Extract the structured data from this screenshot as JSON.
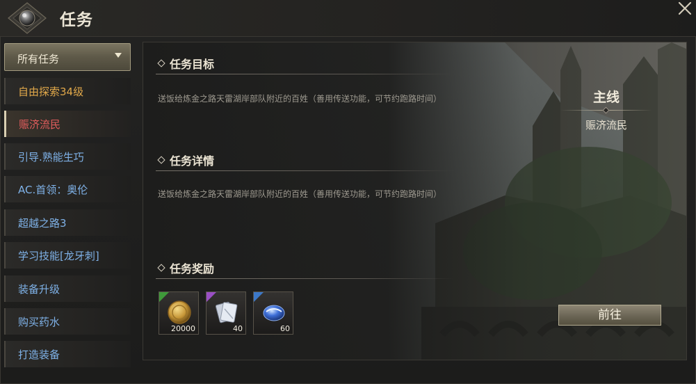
{
  "header": {
    "title": "任务",
    "close_icon": "close-icon"
  },
  "sidebar": {
    "filter": {
      "label": "所有任务"
    },
    "items": [
      {
        "label": "自由探索34级",
        "color": "#e2a94a"
      },
      {
        "label": "赈济流民",
        "color": "#e35d5d",
        "selected": true
      },
      {
        "label": "引导.熟能生巧",
        "color": "#7fb2e8"
      },
      {
        "label": "AC.首领：奥伦",
        "color": "#7fb2e8"
      },
      {
        "label": "超越之路3",
        "color": "#7fb2e8"
      },
      {
        "label": "学习技能[龙牙刺]",
        "color": "#7fb2e8"
      },
      {
        "label": "装备升级",
        "color": "#7fb2e8"
      },
      {
        "label": "购买药水",
        "color": "#7fb2e8"
      },
      {
        "label": "打造装备",
        "color": "#7fb2e8"
      }
    ]
  },
  "main": {
    "objective": {
      "heading": "任务目标",
      "text": "送饭给炼金之路天雷湖岸部队附近的百姓（善用传送功能，可节约跑路时间）"
    },
    "details": {
      "heading": "任务详情",
      "text": "送饭给炼金之路天雷湖岸部队附近的百姓（善用传送功能，可节约跑路时间）"
    },
    "rewards": {
      "heading": "任务奖励",
      "items": [
        {
          "icon": "gold-coin-icon",
          "qty": "20000",
          "corner_color": "#3f9a3a"
        },
        {
          "icon": "scroll-cards-icon",
          "qty": "40",
          "corner_color": "#9a4fc4"
        },
        {
          "icon": "blue-gem-icon",
          "qty": "60",
          "corner_color": "#3c78c8"
        }
      ]
    },
    "quest_type": "主线",
    "quest_name": "赈济流民",
    "goto_label": "前往"
  }
}
